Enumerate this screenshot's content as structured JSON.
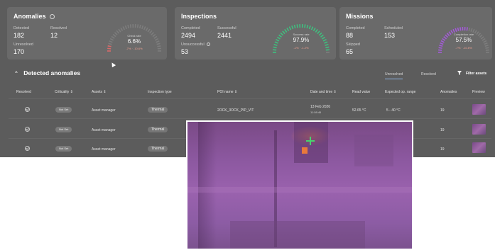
{
  "colors": {
    "background": "#5c5c5c",
    "card": "#6a6a6a",
    "gauge_track": "#7d7d7d",
    "anomalies_gauge": "#d86a6a",
    "inspections_gauge": "#3fbf7f",
    "missions_gauge": "#a35bd8",
    "trend_negative": "#f0a090",
    "active_toggle": "#8fb7e8"
  },
  "anomalies": {
    "title": "Anomalies",
    "detected_label": "Detected",
    "detected_value": "182",
    "resolved_label": "Resolved",
    "resolved_value": "12",
    "unresolved_label": "Unresolved",
    "unresolved_value": "170",
    "gauge_label": "Check rate",
    "gauge_value": "6.6%",
    "gauge_level": 0.066,
    "gauge_trend": "-7% · -10.6%"
  },
  "inspections": {
    "title": "Inspections",
    "completed_label": "Completed",
    "completed_value": "2494",
    "successful_label": "Successful",
    "successful_value": "2441",
    "unsuccessful_label": "Unsuccessful",
    "unsuccessful_value": "53",
    "gauge_label": "Success rate",
    "gauge_value": "97.9%",
    "gauge_level": 0.979,
    "gauge_trend": "-1% · -1.2%"
  },
  "missions": {
    "title": "Missions",
    "completed_label": "Completed",
    "completed_value": "88",
    "scheduled_label": "Scheduled",
    "scheduled_value": "153",
    "skipped_label": "Skipped",
    "skipped_value": "65",
    "gauge_label": "Completion rate",
    "gauge_value": "57.5%",
    "gauge_level": 0.575,
    "gauge_trend": "-7% · -10.6%"
  },
  "section": {
    "title": "Detected anomalies",
    "toggle_unresolved": "Unresolved",
    "toggle_resolved": "Resolved",
    "filter_label": "Filter assets"
  },
  "table": {
    "headers": {
      "resolved": "Resolved",
      "criticality": "Criticality ⇕",
      "assets": "Assets ⇕",
      "inspection_type": "Inspection type",
      "poi_name": "POI name ⇕",
      "datetime": "Date and time ⇕",
      "read_value": "Read value",
      "expected": "Expected op. range",
      "anomalies": "Anomalies",
      "preview": "Preview"
    },
    "rows": [
      {
        "criticality": "Not Set",
        "asset": "Asset manager",
        "type": "Thermal",
        "poi": "2OCK_3OCK_PIP_VIT",
        "date": "13 Feb 2026",
        "time": "11:08:46",
        "read": "52.65 °C",
        "range": "5 - 40 °C",
        "anomalies": "19"
      },
      {
        "criticality": "Not Set",
        "asset": "Asset manager",
        "type": "Thermal",
        "anomalies": "19"
      },
      {
        "criticality": "Not Set",
        "asset": "Asset manager",
        "type": "Thermal",
        "anomalies": "19"
      }
    ]
  },
  "icons": {
    "info": "info-icon",
    "chevron": "chevron-up-icon",
    "filter": "filter-icon",
    "check": "check-circle-icon",
    "sort": "sort-icon"
  }
}
